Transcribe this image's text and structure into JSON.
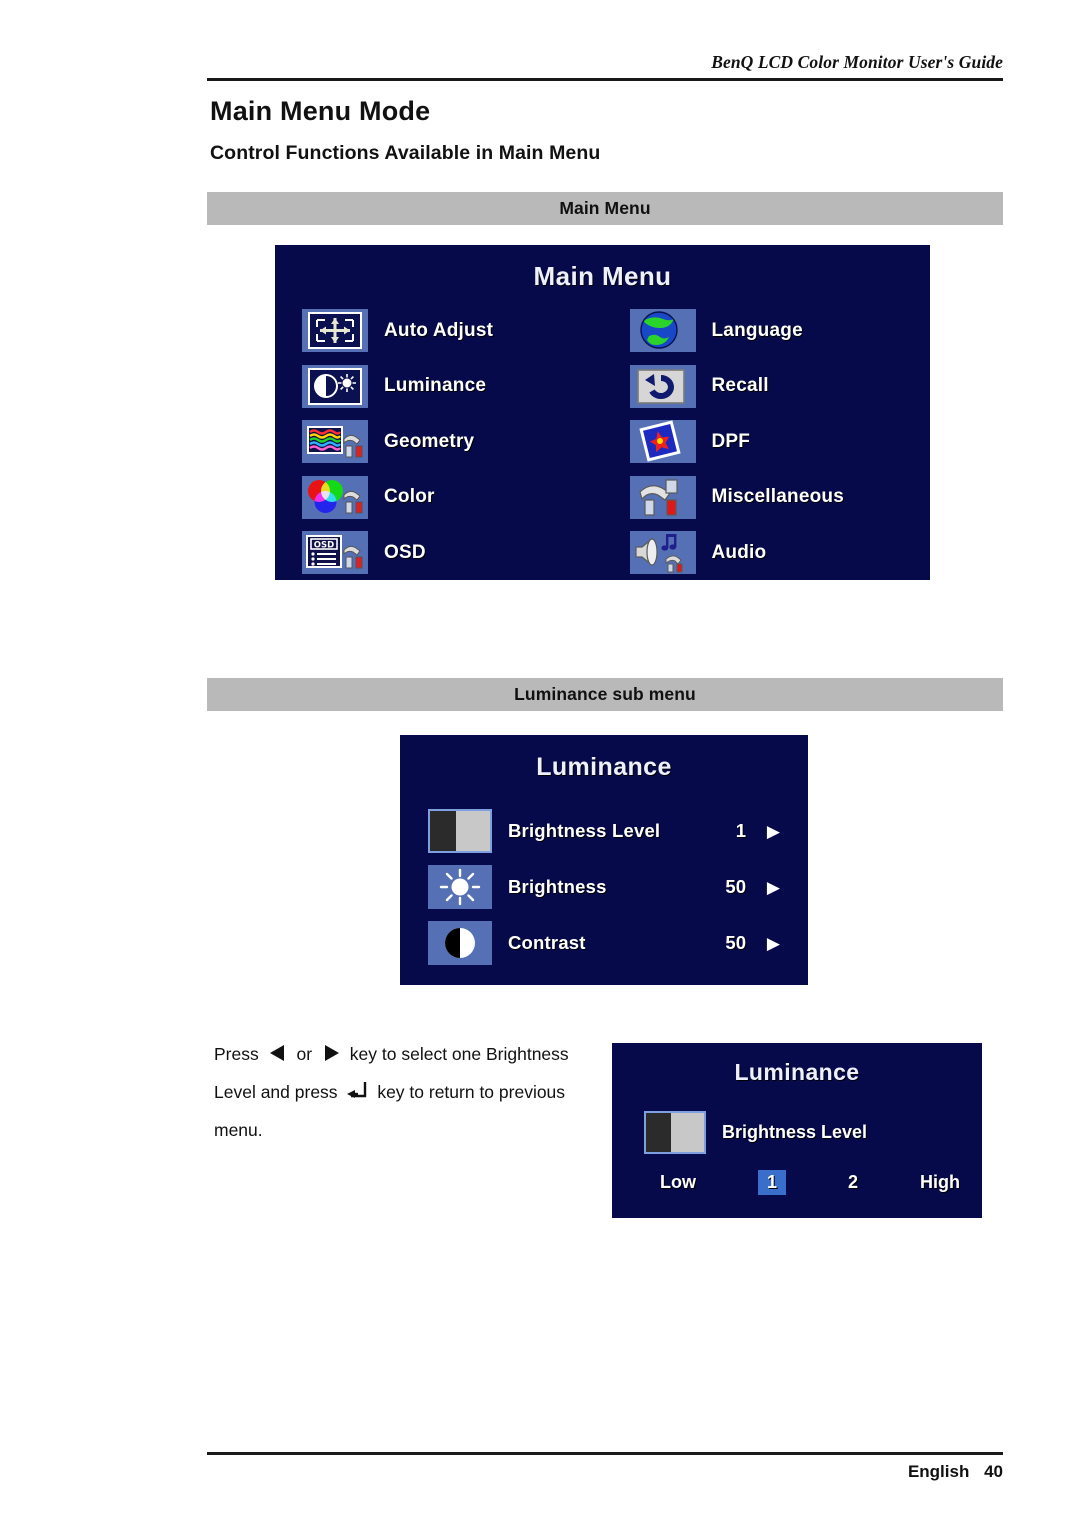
{
  "running_head": "BenQ LCD Color Monitor User's Guide",
  "headings": {
    "h1": "Main Menu Mode",
    "h2": "Control Functions Available in Main Menu"
  },
  "captions": {
    "main_menu": "Main Menu",
    "luminance_sub": "Luminance sub menu"
  },
  "main_menu_osd": {
    "title": "Main Menu",
    "left_items": [
      {
        "icon": "auto-adjust-icon",
        "label": "Auto Adjust"
      },
      {
        "icon": "luminance-icon",
        "label": "Luminance"
      },
      {
        "icon": "geometry-icon",
        "label": "Geometry"
      },
      {
        "icon": "color-icon",
        "label": "Color"
      },
      {
        "icon": "osd-icon",
        "label": "OSD"
      }
    ],
    "right_items": [
      {
        "icon": "language-globe-icon",
        "label": "Language"
      },
      {
        "icon": "recall-undo-icon",
        "label": "Recall"
      },
      {
        "icon": "dpf-picture-icon",
        "label": "DPF"
      },
      {
        "icon": "miscellaneous-tools-icon",
        "label": "Miscellaneous"
      },
      {
        "icon": "audio-speaker-icon",
        "label": "Audio"
      }
    ]
  },
  "luminance_osd": {
    "title": "Luminance",
    "rows": [
      {
        "icon": "brightness-level-icon",
        "label": "Brightness Level",
        "value": "1",
        "arrow": "▶"
      },
      {
        "icon": "brightness-sun-icon",
        "label": "Brightness",
        "value": "50",
        "arrow": "▶"
      },
      {
        "icon": "contrast-icon",
        "label": "Contrast",
        "value": "50",
        "arrow": "▶"
      }
    ]
  },
  "brightness_level_osd": {
    "title": "Luminance",
    "row_icon": "brightness-level-icon",
    "row_label": "Brightness Level",
    "scale": {
      "low_label": "Low",
      "option_1": "1",
      "option_2": "2",
      "high_label": "High",
      "selected": "1"
    }
  },
  "instruction": {
    "part1": "Press",
    "left_key": "◀",
    "part2": "or",
    "right_key": "▶",
    "part3": "key to select one Brightness Level and press",
    "enter_key": "enter-return-key-icon",
    "part4": "key to return to previous menu."
  },
  "footer": {
    "language": "English",
    "page": "40"
  },
  "colors": {
    "osd_background": "#060a4a",
    "icon_tile": "#5570b4",
    "caption_bar": "#b9b9b9",
    "selection_highlight": "#3a6ecb"
  }
}
